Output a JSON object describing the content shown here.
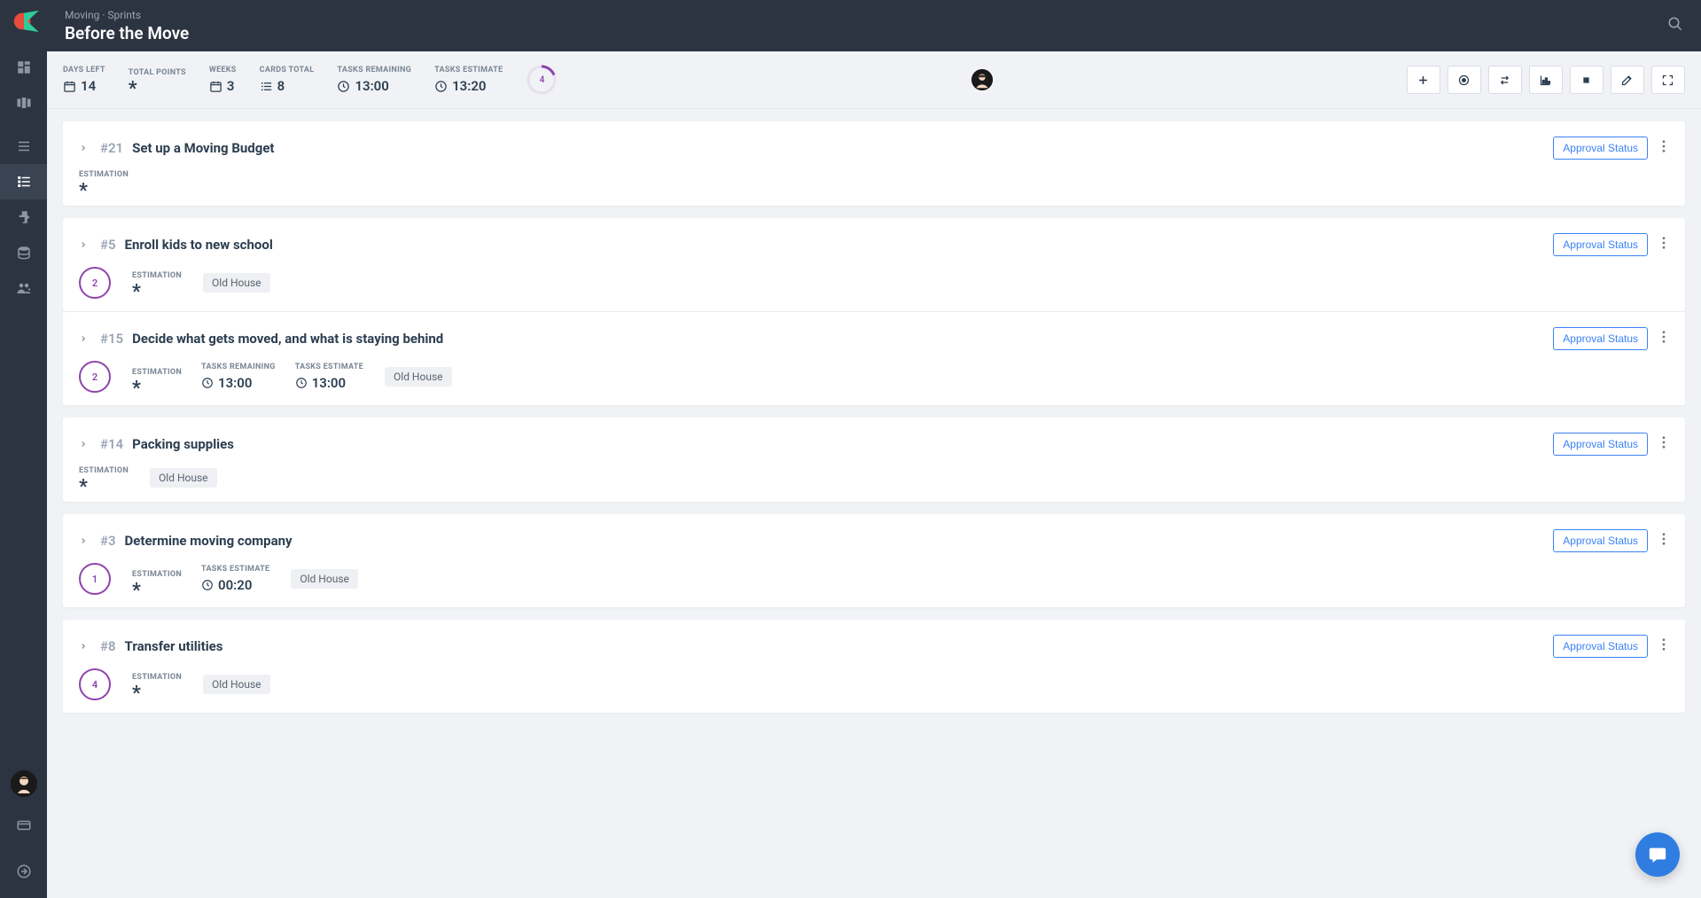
{
  "breadcrumb": "Moving · Sprints",
  "page_title": "Before the Move",
  "stats": {
    "days_left": {
      "label": "DAYS LEFT",
      "value": "14"
    },
    "total_points": {
      "label": "TOTAL POINTS",
      "value": "*"
    },
    "weeks": {
      "label": "WEEKS",
      "value": "3"
    },
    "cards_total": {
      "label": "CARDS TOTAL",
      "value": "8"
    },
    "tasks_remaining": {
      "label": "TASKS REMAINING",
      "value": "13:00"
    },
    "tasks_estimate": {
      "label": "TASKS ESTIMATE",
      "value": "13:20"
    },
    "progress_value": "4"
  },
  "approval_label": "Approval Status",
  "estimation_label": "ESTIMATION",
  "tasks_remaining_label": "TASKS REMAINING",
  "tasks_estimate_label": "TASKS ESTIMATE",
  "tag_old_house": "Old House",
  "cards": [
    {
      "id": "#21",
      "title": "Set up a Moving Budget",
      "ring": null,
      "estimation": "*",
      "tasks_remaining": null,
      "tasks_estimate": null,
      "tag": null
    },
    {
      "id": "#5",
      "title": "Enroll kids to new school",
      "ring": "2",
      "estimation": "*",
      "tasks_remaining": null,
      "tasks_estimate": null,
      "tag": "Old House"
    },
    {
      "id": "#15",
      "title": "Decide what gets moved, and what is staying behind",
      "ring": "2",
      "estimation": "*",
      "tasks_remaining": "13:00",
      "tasks_estimate": "13:00",
      "tag": "Old House"
    },
    {
      "id": "#14",
      "title": "Packing supplies",
      "ring": null,
      "estimation": "*",
      "tasks_remaining": null,
      "tasks_estimate": null,
      "tag": "Old House"
    },
    {
      "id": "#3",
      "title": "Determine moving company",
      "ring": "1",
      "estimation": "*",
      "tasks_remaining": null,
      "tasks_estimate": "00:20",
      "tag": "Old House"
    },
    {
      "id": "#8",
      "title": "Transfer utilities",
      "ring": "4",
      "estimation": "*",
      "tasks_remaining": null,
      "tasks_estimate": null,
      "tag": "Old House"
    }
  ],
  "card_groups": [
    [
      0
    ],
    [
      1,
      2
    ],
    [
      3
    ],
    [
      4
    ],
    [
      5
    ]
  ]
}
